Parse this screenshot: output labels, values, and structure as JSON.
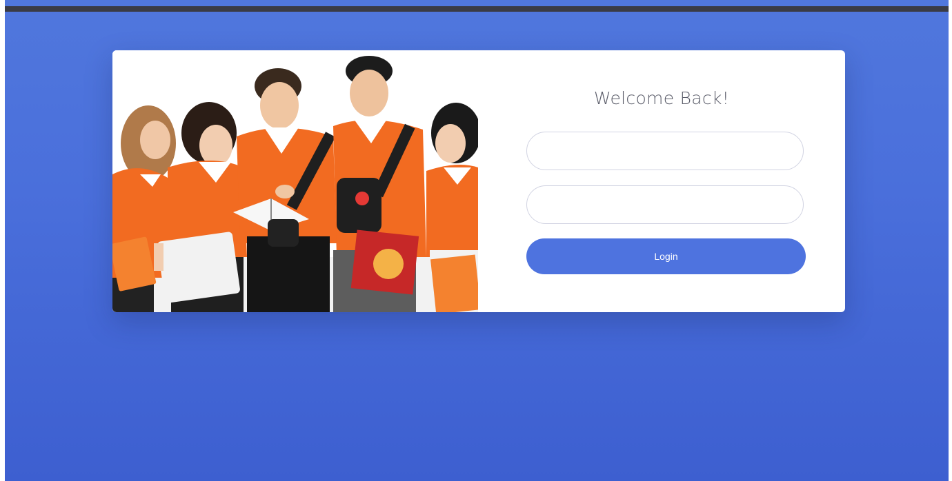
{
  "login": {
    "heading": "Welcome Back!",
    "username": {
      "value": "",
      "placeholder": ""
    },
    "password": {
      "value": "",
      "placeholder": ""
    },
    "submit_label": "Login"
  },
  "image": {
    "description_icon": "students-photo"
  },
  "colors": {
    "background": "#4e73df",
    "topbar": "#3a3b45",
    "button": "#4e73df",
    "shirt": "#f26b21"
  }
}
